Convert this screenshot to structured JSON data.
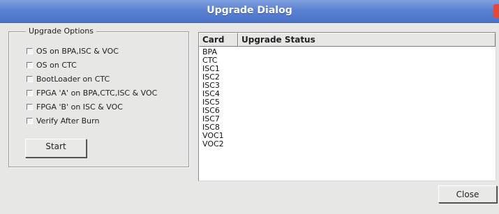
{
  "window": {
    "title": "Upgrade Dialog"
  },
  "options": {
    "group_label": "Upgrade Options",
    "items": [
      {
        "label": "OS on BPA,ISC & VOC",
        "checked": false
      },
      {
        "label": "OS on CTC",
        "checked": false
      },
      {
        "label": "BootLoader on CTC",
        "checked": false
      },
      {
        "label": "FPGA 'A' on BPA,CTC,ISC & VOC",
        "checked": false
      },
      {
        "label": "FPGA 'B' on ISC & VOC",
        "checked": false
      },
      {
        "label": "Verify After Burn",
        "checked": false
      }
    ],
    "start_label": "Start"
  },
  "table": {
    "columns": [
      "Card",
      "Upgrade Status"
    ],
    "rows": [
      {
        "card": "BPA",
        "status": ""
      },
      {
        "card": "CTC",
        "status": ""
      },
      {
        "card": "ISC1",
        "status": ""
      },
      {
        "card": "ISC2",
        "status": ""
      },
      {
        "card": "ISC3",
        "status": ""
      },
      {
        "card": "ISC4",
        "status": ""
      },
      {
        "card": "ISC5",
        "status": ""
      },
      {
        "card": "ISC6",
        "status": ""
      },
      {
        "card": "ISC7",
        "status": ""
      },
      {
        "card": "ISC8",
        "status": ""
      },
      {
        "card": "VOC1",
        "status": ""
      },
      {
        "card": "VOC2",
        "status": ""
      }
    ]
  },
  "footer": {
    "close_label": "Close"
  },
  "colors": {
    "titlebar": "#5b82d2",
    "window_bg": "#e7e7e6",
    "close_box": "#e04a3a"
  }
}
